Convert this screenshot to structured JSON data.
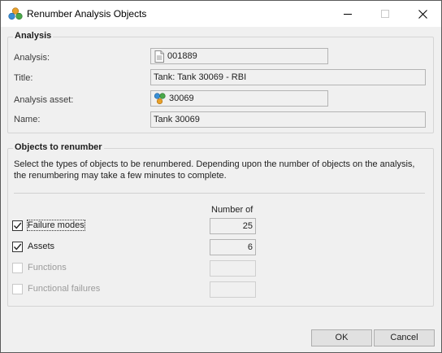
{
  "window": {
    "title": "Renumber Analysis Objects",
    "minimize": "—",
    "maximize": "☐",
    "close": "✕"
  },
  "analysis": {
    "group_title": "Analysis",
    "analysis_label": "Analysis:",
    "analysis_value": "001889",
    "title_label": "Title:",
    "title_value": "Tank: Tank 30069 - RBI",
    "asset_label": "Analysis asset:",
    "asset_value": "30069",
    "name_label": "Name:",
    "name_value": "Tank 30069"
  },
  "objects": {
    "group_title": "Objects to renumber",
    "description": "Select the types of objects to be renumbered.  Depending upon the number of objects on the analysis, the  renumbering may take a few minutes to complete.",
    "column_header": "Number of",
    "items": [
      {
        "label": "Failure modes",
        "checked": true,
        "enabled": true,
        "count": "25"
      },
      {
        "label": "Assets",
        "checked": true,
        "enabled": true,
        "count": "6"
      },
      {
        "label": "Functions",
        "checked": false,
        "enabled": false,
        "count": ""
      },
      {
        "label": "Functional failures",
        "checked": false,
        "enabled": false,
        "count": ""
      }
    ]
  },
  "buttons": {
    "ok": "OK",
    "cancel": "Cancel"
  },
  "icons": {
    "title": "asset-tree-icon",
    "analysis": "document-icon",
    "asset": "asset-icon"
  }
}
